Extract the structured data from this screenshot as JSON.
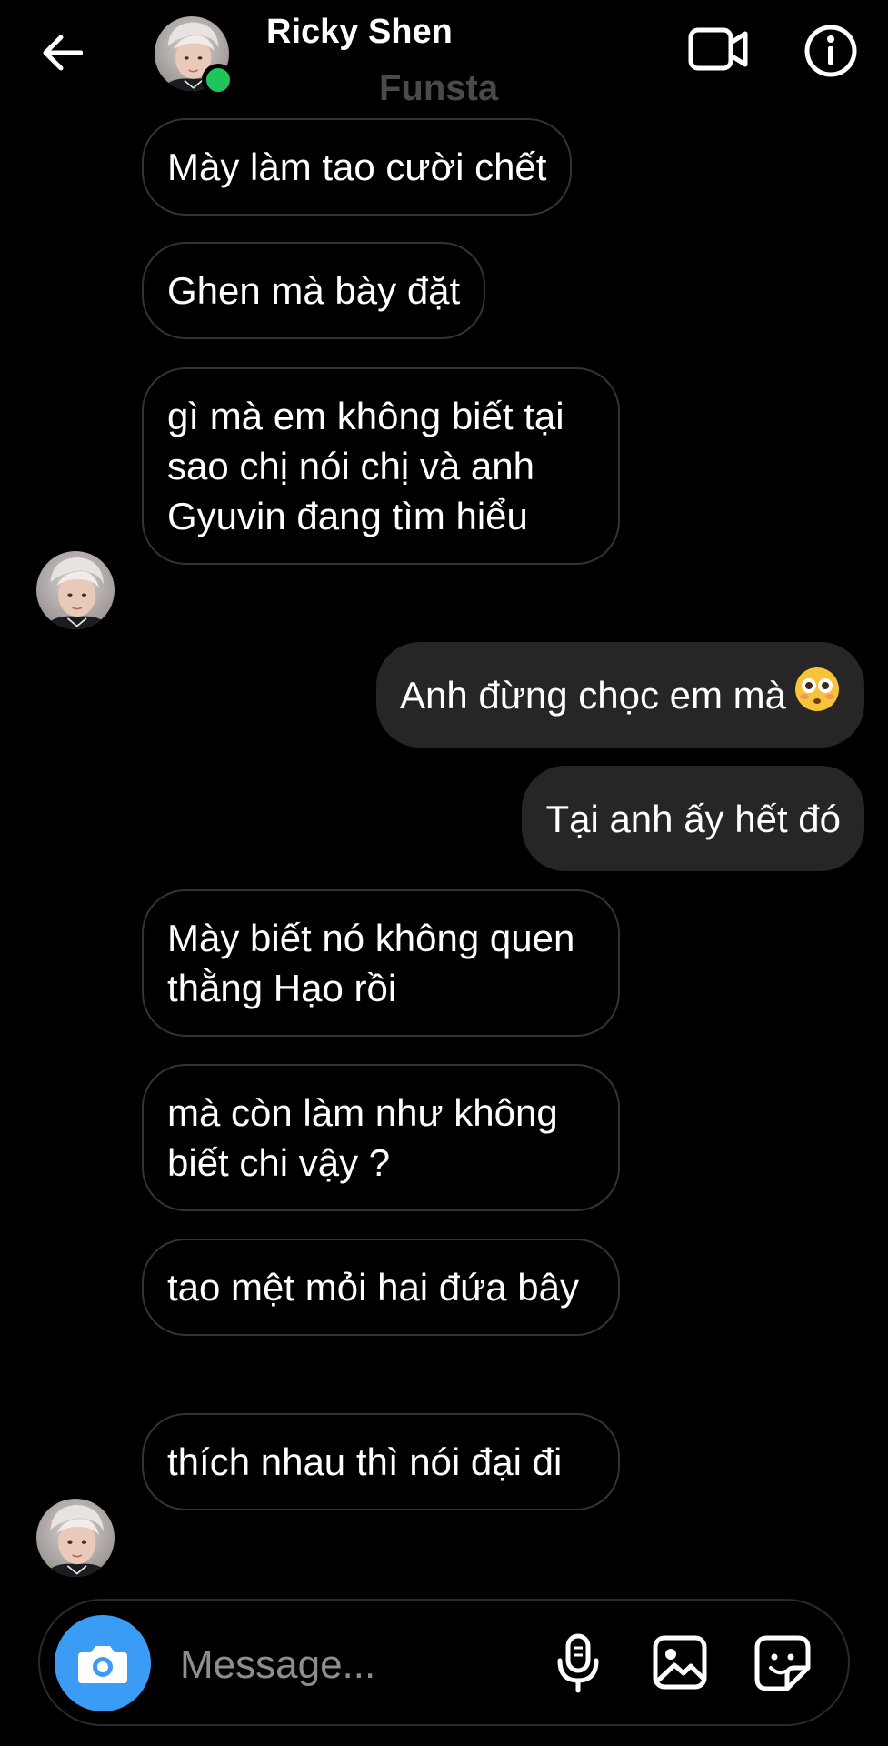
{
  "header": {
    "name": "Ricky Shen",
    "subtitle": "Funsta",
    "online_color": "#1fc45b"
  },
  "messages": [
    {
      "side": "received",
      "text": "Mày làm tao cười chết"
    },
    {
      "side": "received",
      "text": "Ghen mà bày đặt"
    },
    {
      "side": "received",
      "text": "gì mà em không biết tại sao chị nói chị và anh Gyuvin đang tìm hiểu"
    },
    {
      "side": "sent",
      "text": "Anh đừng chọc em mà",
      "emoji": "flushed-face-emoji"
    },
    {
      "side": "sent",
      "text": "Tại anh ấy hết đó"
    },
    {
      "side": "received",
      "text": "Mày biết nó không quen thằng Hạo rồi"
    },
    {
      "side": "received",
      "text": "mà còn làm như không biết chi vậy ?"
    },
    {
      "side": "received",
      "text": "tao mệt mỏi hai đứa bây"
    },
    {
      "side": "received",
      "text": "thích nhau thì nói đại đi"
    }
  ],
  "composer": {
    "placeholder": "Message...",
    "accent": "#3b9cf5"
  },
  "icons": {
    "back": "arrow-left-icon",
    "video": "video-camera-icon",
    "info": "info-icon",
    "camera": "camera-icon",
    "mic": "microphone-icon",
    "gallery": "image-icon",
    "sticker": "sticker-icon"
  },
  "colors": {
    "background": "#000000",
    "sent_bubble": "#262626",
    "received_border": "#333333",
    "subtitle": "#4a4a4a"
  }
}
